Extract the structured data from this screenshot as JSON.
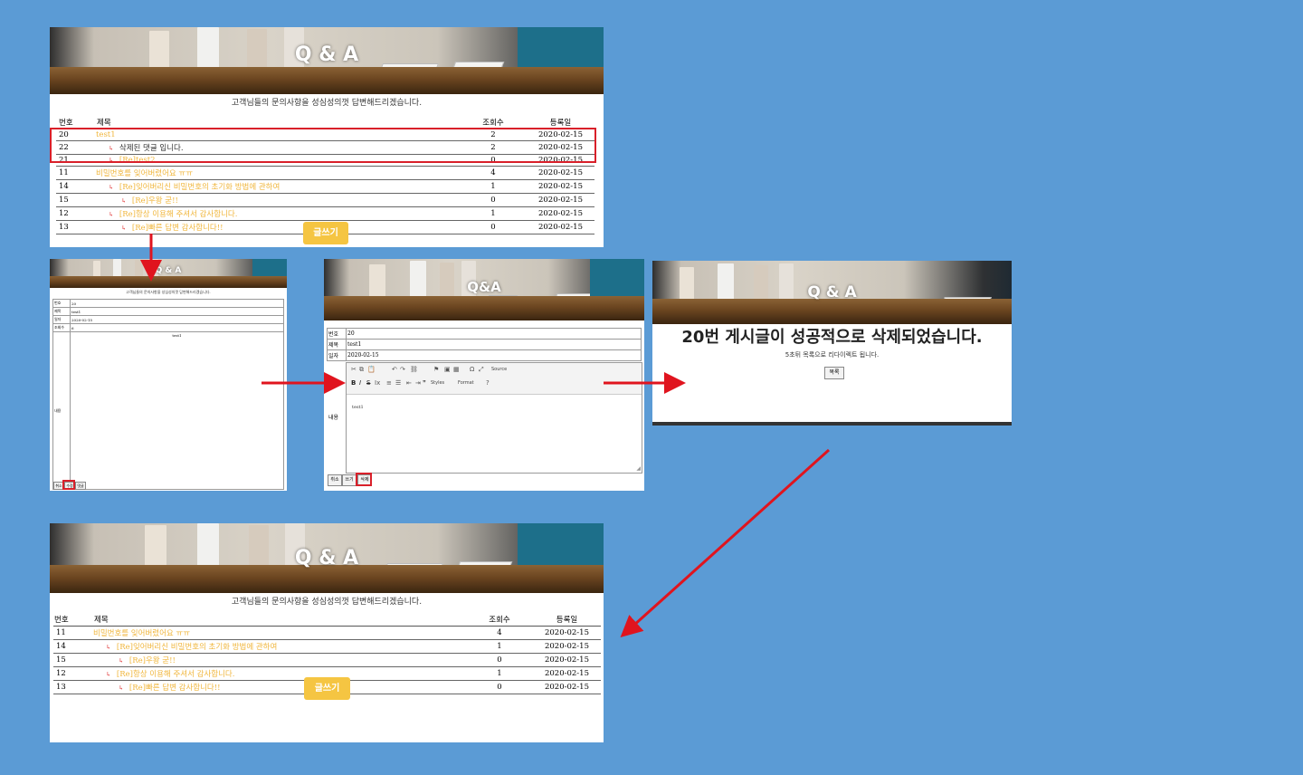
{
  "panel1": {
    "banner_title": "Q & A",
    "subtitle": "고객님들의 문의사항을 성심성의껏 답변해드리겠습니다.",
    "headers": {
      "no": "번호",
      "title": "제목",
      "views": "조회수",
      "date": "등록일"
    },
    "rows": [
      {
        "no": "20",
        "title": "test1",
        "views": "2",
        "date": "2020-02-15",
        "style": "gold",
        "indent": 0
      },
      {
        "no": "22",
        "title": "삭제된 댓글 입니다.",
        "views": "2",
        "date": "2020-02-15",
        "style": "dark",
        "indent": 1
      },
      {
        "no": "21",
        "title": "[Re]test2",
        "views": "0",
        "date": "2020-02-15",
        "style": "gold",
        "indent": 1
      },
      {
        "no": "11",
        "title": "비밀번호를 잊어버렸어요 ㅠㅠ",
        "views": "4",
        "date": "2020-02-15",
        "style": "gold",
        "indent": 0
      },
      {
        "no": "14",
        "title": "[Re]잊어버리신 비밀번호의 초기화 방법에 관하여",
        "views": "1",
        "date": "2020-02-15",
        "style": "gold",
        "indent": 1
      },
      {
        "no": "15",
        "title": "[Re]우왕 굳!!",
        "views": "0",
        "date": "2020-02-15",
        "style": "gold",
        "indent": 2
      },
      {
        "no": "12",
        "title": "[Re]항상 이용해 주셔서 감사합니다.",
        "views": "1",
        "date": "2020-02-15",
        "style": "gold",
        "indent": 1
      },
      {
        "no": "13",
        "title": "[Re]빠른 답변 감사합니다!!",
        "views": "0",
        "date": "2020-02-15",
        "style": "gold",
        "indent": 2
      }
    ],
    "write_label": "글쓰기"
  },
  "panel2": {
    "banner_title": "Q & A",
    "subtitle": "고객님들의 문의사항을 성심성의껏 답변해드리겠습니다.",
    "fields": [
      {
        "label": "번호",
        "value": "20"
      },
      {
        "label": "제목",
        "value": "test1"
      },
      {
        "label": "일자",
        "value": "2020-02-15"
      },
      {
        "label": "조회수",
        "value": "6"
      }
    ],
    "content_label": "내용",
    "content_value": "test1",
    "buttons": [
      "취소",
      "수정",
      "댓글"
    ]
  },
  "panel3": {
    "banner_title": "Q&A",
    "fields": [
      {
        "label": "번호",
        "value": "20"
      },
      {
        "label": "제목",
        "value": "test1"
      },
      {
        "label": "일자",
        "value": "2020-02-15"
      }
    ],
    "toolbar_source": "Source",
    "toolbar_styles": "Styles",
    "toolbar_format": "Format",
    "content_label": "내용",
    "content_value": "test1",
    "buttons": [
      "취소",
      "쓰기",
      "삭제"
    ]
  },
  "panel4": {
    "banner_title": "Q & A",
    "message": "20번 게시글이 성공적으로 삭제되었습니다.",
    "redirect_note": "5초뒤 목록으로 리다이렉트 됩니다.",
    "list_button": "목록"
  },
  "panel5": {
    "banner_title": "Q & A",
    "subtitle": "고객님들의 문의사항을 성심성의껏 답변해드리겠습니다.",
    "headers": {
      "no": "번호",
      "title": "제목",
      "views": "조회수",
      "date": "등록일"
    },
    "rows": [
      {
        "no": "11",
        "title": "비밀번호를 잊어버렸어요 ㅠㅠ",
        "views": "4",
        "date": "2020-02-15",
        "style": "gold",
        "indent": 0
      },
      {
        "no": "14",
        "title": "[Re]잊어버리신 비밀번호의 초기화 방법에 관하여",
        "views": "1",
        "date": "2020-02-15",
        "style": "gold",
        "indent": 1
      },
      {
        "no": "15",
        "title": "[Re]우왕 굳!!",
        "views": "0",
        "date": "2020-02-15",
        "style": "gold",
        "indent": 2
      },
      {
        "no": "12",
        "title": "[Re]항상 이용해 주셔서 감사합니다.",
        "views": "1",
        "date": "2020-02-15",
        "style": "gold",
        "indent": 1
      },
      {
        "no": "13",
        "title": "[Re]빠른 답변 감사합니다!!",
        "views": "0",
        "date": "2020-02-15",
        "style": "gold",
        "indent": 2
      }
    ],
    "write_label": "글쓰기"
  },
  "colors": {
    "background": "#5b9bd5",
    "accent": "#f5c542",
    "link": "#f0b63c",
    "annotation": "#d9202a"
  },
  "icons": {
    "reply": "reply-arrow-icon",
    "flow": "flow-arrow-icon"
  }
}
